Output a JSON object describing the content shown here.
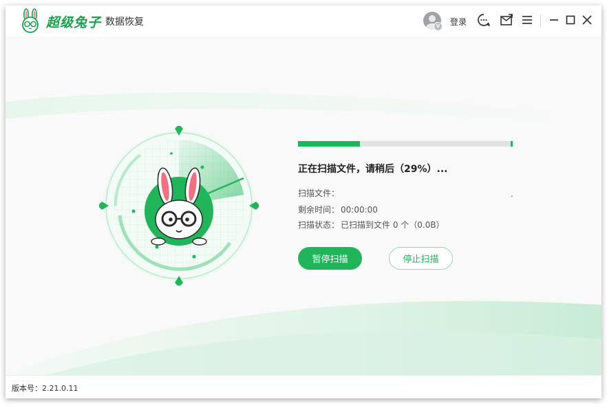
{
  "app": {
    "brand_name": "超级兔子",
    "product_name": "数据恢复",
    "brand_color": "#21b55a"
  },
  "titlebar": {
    "avatar_badge": "V",
    "login_label": "登录",
    "icons": [
      "support-chat-icon",
      "message-icon",
      "menu-icon",
      "minimize-icon",
      "maximize-icon",
      "close-icon"
    ]
  },
  "scan": {
    "progress_fraction": 0.29,
    "status_title": "正在扫描文件，请稍后（29%）...",
    "file_label": "扫描文件：",
    "file_value": "",
    "trail": ".",
    "remaining_label": "剩余时间：",
    "remaining_value": "00:00:00",
    "state_label": "扫描状态：",
    "state_value": "已扫描到文件 0 个（0.0B）",
    "pause_label": "暂停扫描",
    "stop_label": "停止扫描"
  },
  "footer": {
    "version": "版本号：2.21.0.11"
  }
}
